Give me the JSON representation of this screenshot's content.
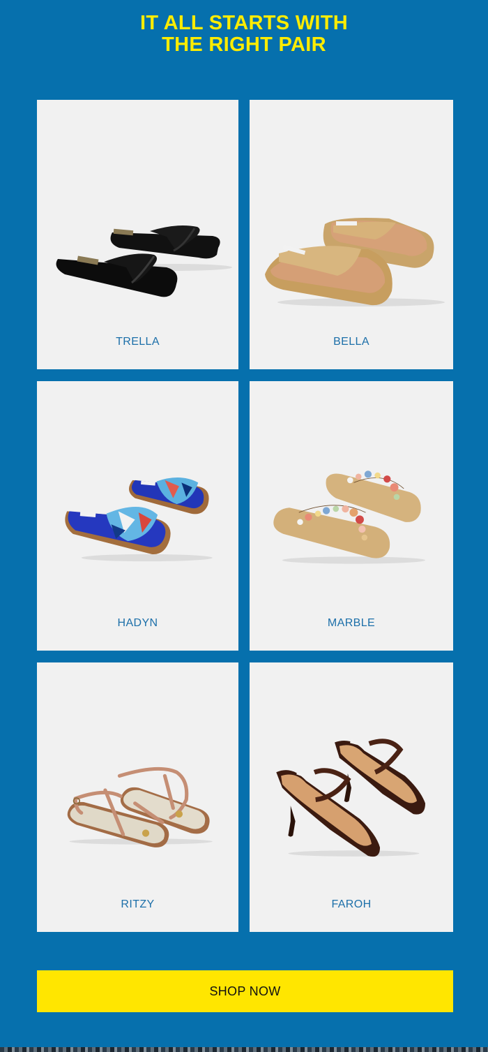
{
  "headline": {
    "line1": "IT ALL STARTS WITH",
    "line2": "THE RIGHT PAIR"
  },
  "products": [
    {
      "name": "TRELLA"
    },
    {
      "name": "BELLA"
    },
    {
      "name": "HADYN"
    },
    {
      "name": "MARBLE"
    },
    {
      "name": "RITZY"
    },
    {
      "name": "FAROH"
    }
  ],
  "cta": {
    "label": "SHOP NOW"
  },
  "colors": {
    "background": "#0670ad",
    "headline": "#ffec00",
    "card": "#f1f1f1",
    "product_name": "#1c6fa9",
    "button": "#ffe600"
  }
}
